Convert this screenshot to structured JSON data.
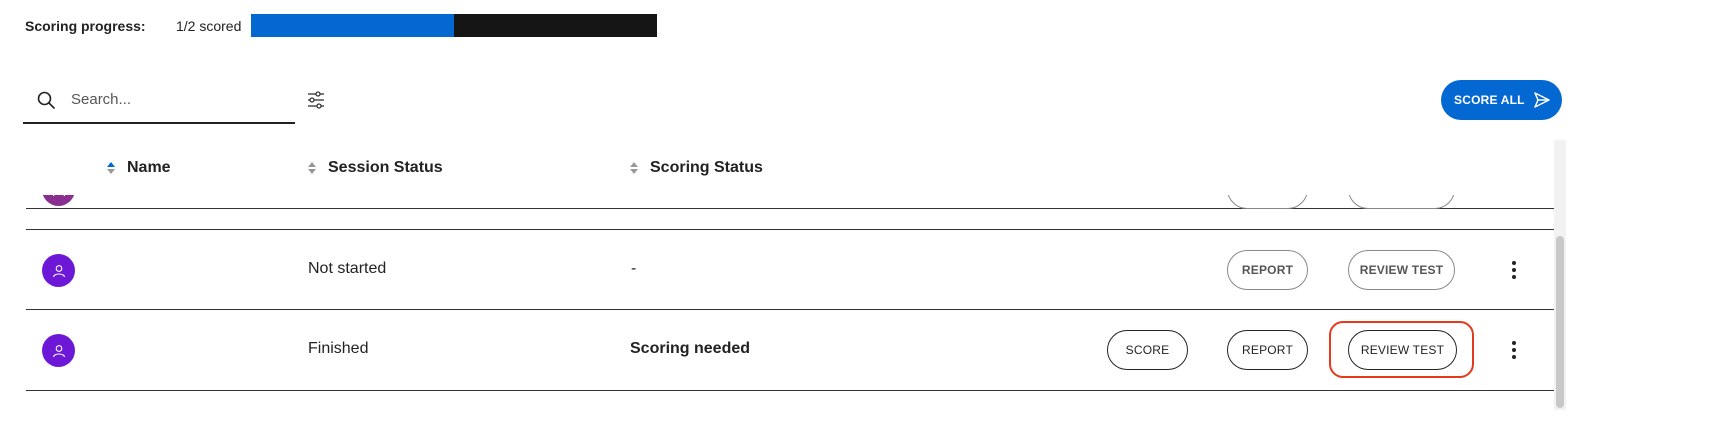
{
  "progress": {
    "label": "Scoring progress:",
    "count_text": "1/2 scored",
    "fraction": 0.5,
    "fill_color": "#0468d2",
    "track_color": "#151515"
  },
  "search": {
    "placeholder": "Search...",
    "value": "",
    "icon": "search-icon"
  },
  "filter": {
    "icon": "filter-sliders-icon"
  },
  "score_all": {
    "label": "SCORE ALL",
    "icon": "send-icon",
    "color": "#0468d2"
  },
  "table": {
    "columns": [
      {
        "label": "Name",
        "sort": "ascending"
      },
      {
        "label": "Session Status",
        "sort": "none"
      },
      {
        "label": "Scoring Status",
        "sort": "none"
      }
    ],
    "rows": [
      {
        "avatar": "user-icon",
        "name": "",
        "session_status": "",
        "scoring_status": "",
        "report_label": "",
        "review_label": ""
      },
      {
        "avatar": "user-icon",
        "name": "",
        "session_status": "Not started",
        "scoring_status": "-",
        "report_label": "REPORT",
        "review_label": "REVIEW TEST"
      },
      {
        "avatar": "user-icon",
        "name": "",
        "session_status": "Finished",
        "scoring_status": "Scoring needed",
        "score_label": "SCORE",
        "report_label": "REPORT",
        "review_label": "REVIEW TEST"
      }
    ]
  },
  "colors": {
    "avatar": "#6c18d6",
    "highlight": "#e5391e",
    "accent": "#0468d2"
  }
}
